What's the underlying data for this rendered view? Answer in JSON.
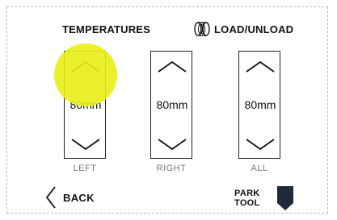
{
  "tabs": {
    "temperatures": "TEMPERATURES",
    "load_unload": "LOAD/UNLOAD",
    "load_unload_icon": "filament-spool-icon"
  },
  "columns": [
    {
      "value": "80mm",
      "label": "LEFT"
    },
    {
      "value": "80mm",
      "label": "RIGHT"
    },
    {
      "value": "80mm",
      "label": "ALL"
    }
  ],
  "footer": {
    "back_label": "BACK",
    "park_label_line1": "PARK",
    "park_label_line2": "TOOL"
  },
  "colors": {
    "highlight": "#e8ee14",
    "border": "#b8b8b8",
    "text": "#111111",
    "muted": "#777777"
  }
}
